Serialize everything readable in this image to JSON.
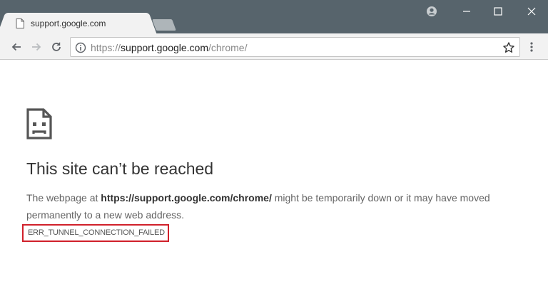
{
  "browser": {
    "tab": {
      "title": "support.google.com",
      "icon": "page-icon"
    },
    "window_controls": [
      "profile-icon",
      "minimize-icon",
      "maximize-icon",
      "close-icon"
    ],
    "omnibox": {
      "scheme": "https://",
      "host": "support.google.com",
      "path": "/chrome/"
    }
  },
  "error_page": {
    "icon": "sad-page-icon",
    "heading": "This site can’t be reached",
    "message_before": "The webpage at ",
    "message_url": "https://support.google.com/chrome/",
    "message_after": " might be temporarily down or it may have moved permanently to a new web address.",
    "error_code": "ERR_TUNNEL_CONNECTION_FAILED",
    "highlight_color": "#d0202a"
  },
  "colors": {
    "titlebar": "#57646c",
    "toolbar": "#f2f2f2",
    "text": "#333333",
    "muted_text": "#646464"
  }
}
